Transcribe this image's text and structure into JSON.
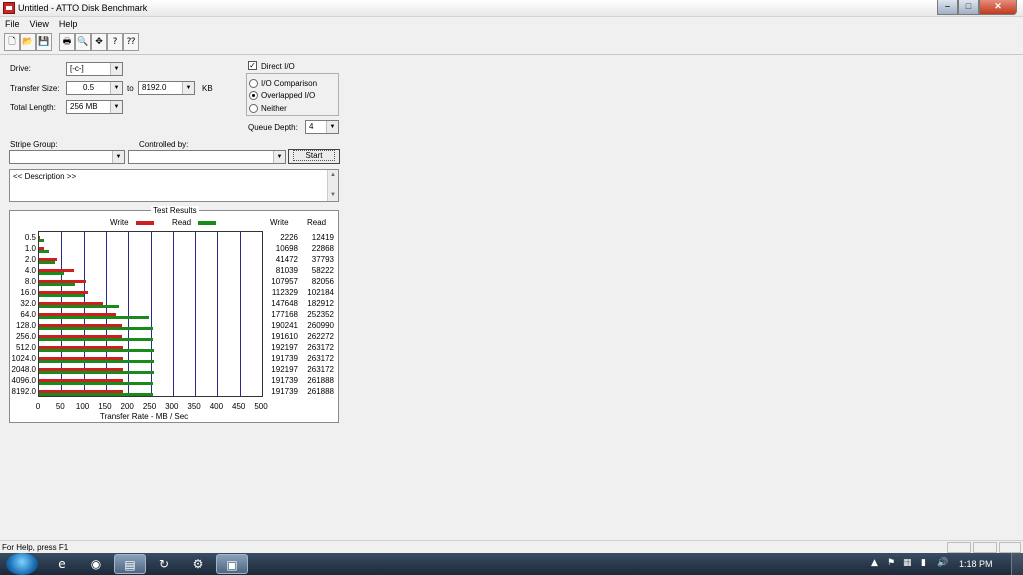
{
  "window": {
    "title": "Untitled - ATTO Disk Benchmark",
    "min": "–",
    "max": "□",
    "close": "✕"
  },
  "menu": [
    "File",
    "View",
    "Help"
  ],
  "toolbar_icons": [
    "new-file-icon",
    "open-folder-icon",
    "save-icon",
    "print-icon",
    "print-preview-icon",
    "move-icon",
    "help-icon",
    "context-help-icon"
  ],
  "toolbar_glyphs": [
    "🗋",
    "📂",
    "💾",
    "🖶",
    "🔍",
    "✥",
    "?",
    "⁇"
  ],
  "form": {
    "drive_label": "Drive:",
    "drive_value": "[-c-]",
    "transfer_label": "Transfer Size:",
    "transfer_from": "0.5",
    "to_label": "to",
    "transfer_to": "8192.0",
    "kb_label": "KB",
    "total_length_label": "Total Length:",
    "total_length_value": "256 MB",
    "direct_io_label": "Direct I/O",
    "io_comparison_label": "I/O Comparison",
    "overlapped_io_label": "Overlapped I/O",
    "neither_label": "Neither",
    "queue_depth_label": "Queue Depth:",
    "queue_depth_value": "4",
    "stripe_group_label": "Stripe Group:",
    "controlled_by_label": "Controlled by:",
    "start_label": "Start",
    "description_text": "<< Description >>"
  },
  "results": {
    "title": "Test Results",
    "write_legend": "Write",
    "read_legend": "Read",
    "write_header": "Write",
    "read_header": "Read",
    "x_title": "Transfer Rate - MB / Sec",
    "write_color": "#cc2020",
    "read_color": "#1a8a1a"
  },
  "chart_data": {
    "type": "bar",
    "orientation": "horizontal",
    "title": "Test Results",
    "xlabel": "Transfer Rate - MB / Sec",
    "xlim": [
      0,
      500
    ],
    "xticks": [
      "0",
      "50",
      "100",
      "150",
      "200",
      "250",
      "300",
      "350",
      "400",
      "450",
      "500"
    ],
    "categories": [
      "0.5",
      "1.0",
      "2.0",
      "4.0",
      "8.0",
      "16.0",
      "32.0",
      "64.0",
      "128.0",
      "256.0",
      "512.0",
      "1024.0",
      "2048.0",
      "4096.0",
      "8192.0"
    ],
    "series": [
      {
        "name": "Write",
        "values": [
          2226,
          10698,
          41472,
          81039,
          107957,
          112329,
          147648,
          177168,
          190241,
          191610,
          192197,
          191739,
          192197,
          191739,
          191739
        ]
      },
      {
        "name": "Read",
        "values": [
          12419,
          22868,
          37793,
          58222,
          82056,
          102184,
          182912,
          252352,
          260990,
          262272,
          263172,
          263172,
          263172,
          261888,
          261888
        ]
      }
    ]
  },
  "status": {
    "help_text": "For Help, press F1"
  },
  "taskbar": {
    "clock": "1:18 PM",
    "apps": [
      "ie-icon",
      "firefox-icon",
      "explorer-icon",
      "steam-icon",
      "settings-icon",
      "atto-icon"
    ],
    "app_glyphs": [
      "e",
      "◉",
      "▤",
      "↻",
      "⚙",
      "▣"
    ],
    "tray_glyphs": [
      "▲",
      "⚑",
      "▦",
      "▮",
      "🔊"
    ]
  }
}
